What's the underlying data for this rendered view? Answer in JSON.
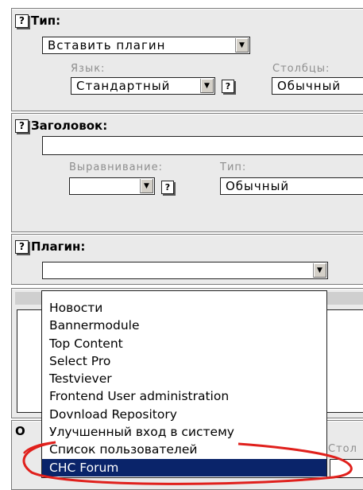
{
  "type_section": {
    "title": "Тип:",
    "type_value": "Вставить плагин",
    "language_label": "Язык:",
    "language_value": "Стандартный",
    "columns_label": "Столбцы:",
    "columns_value": "Обычный"
  },
  "header_section": {
    "title": "Заголовок:",
    "align_label": "Выравнивание:",
    "type_label": "Тип:",
    "type_value": "Обычный"
  },
  "plugin_section": {
    "title": "Плагин:",
    "selected": "",
    "options": [
      "Новости",
      "Bannermodule",
      "Top Content",
      "Select Pro",
      "Testviever",
      "Frontend User administration",
      "Dovnload Repository",
      "Улучшенный вход в систему",
      "Список пользователей",
      "CHC Forum"
    ],
    "highlighted_option": "CHC Forum"
  },
  "bottom_section": {
    "title_fragment": "О",
    "column_label_fragment": "Стол"
  },
  "icons": {
    "help": "help-icon",
    "dropdown": "chevron-down-icon"
  },
  "colors": {
    "panel": "#eaeaea",
    "highlight": "#0a246a",
    "annotation": "#e0201c"
  }
}
